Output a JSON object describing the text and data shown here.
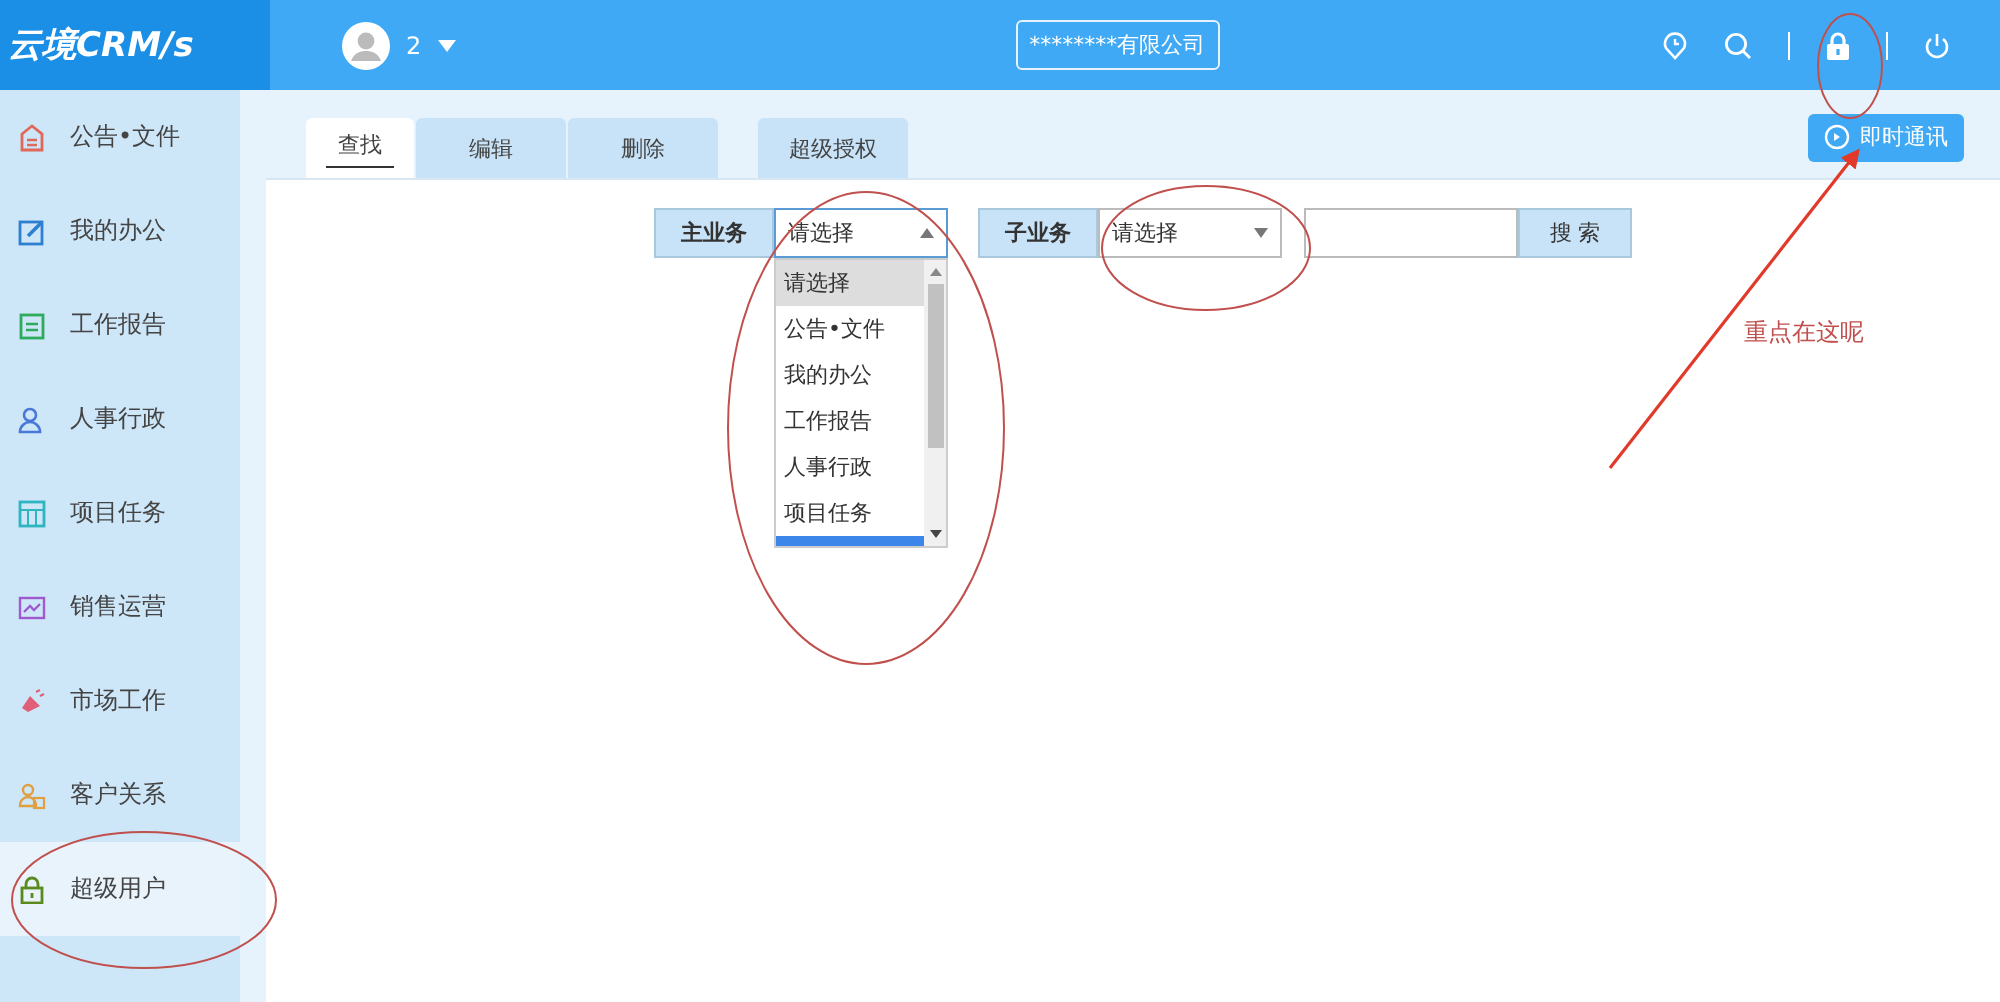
{
  "header": {
    "logo": "云境CRM/s",
    "user": "2",
    "company": "********有限公司"
  },
  "sidebar": {
    "items": [
      {
        "label": "公告•文件",
        "kind": "notice",
        "color": "#e0685a",
        "selected": false
      },
      {
        "label": "我的办公",
        "kind": "edit",
        "color": "#2f7fd0",
        "selected": false
      },
      {
        "label": "工作报告",
        "kind": "report",
        "color": "#2eaa5c",
        "selected": false
      },
      {
        "label": "人事行政",
        "kind": "person",
        "color": "#4a78d8",
        "selected": false
      },
      {
        "label": "项目任务",
        "kind": "grid",
        "color": "#2fb5c0",
        "selected": false
      },
      {
        "label": "销售运营",
        "kind": "chart",
        "color": "#a05ad0",
        "selected": false
      },
      {
        "label": "市场工作",
        "kind": "horn",
        "color": "#e0607a",
        "selected": false
      },
      {
        "label": "客户关系",
        "kind": "people",
        "color": "#e0a040",
        "selected": false
      },
      {
        "label": "超级用户",
        "kind": "lock",
        "color": "#5a8a1e",
        "selected": true
      }
    ]
  },
  "tabs": [
    {
      "label": "查找",
      "selected": true
    },
    {
      "label": "编辑",
      "selected": false
    },
    {
      "label": "删除",
      "selected": false
    },
    {
      "label": "超级授权",
      "selected": false
    }
  ],
  "chat_button": "即时通讯",
  "search_form": {
    "main_label": "主业务",
    "main_value": "请选择",
    "main_open": true,
    "sub_label": "子业务",
    "sub_value": "请选择",
    "search_button": "搜 索"
  },
  "dropdown": {
    "options": [
      {
        "label": "请选择",
        "selected": true
      },
      {
        "label": "公告•文件",
        "selected": false
      },
      {
        "label": "我的办公",
        "selected": false
      },
      {
        "label": "工作报告",
        "selected": false
      },
      {
        "label": "人事行政",
        "selected": false
      },
      {
        "label": "项目任务",
        "selected": false
      }
    ]
  },
  "annotation": {
    "note": "重点在这呢"
  }
}
